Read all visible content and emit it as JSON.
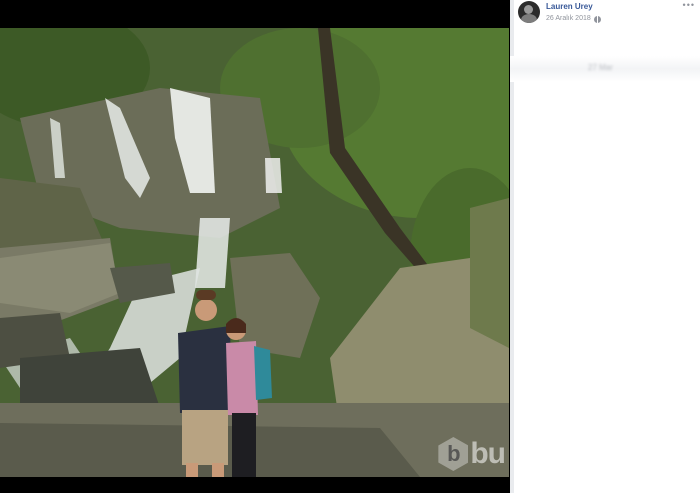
{
  "post": {
    "author": "Lauren Urey",
    "date": "26 Aralık 2018",
    "more_icon": "more-options-icon",
    "privacy_icon": "globe-icon",
    "blurred_text": "27 Mar"
  },
  "watermark": {
    "logo_letter": "b",
    "text": "bu"
  },
  "colors": {
    "author_link": "#385898",
    "meta_text": "#90949c",
    "sidebar_bg": "#ffffff",
    "viewer_bg": "#000000"
  }
}
